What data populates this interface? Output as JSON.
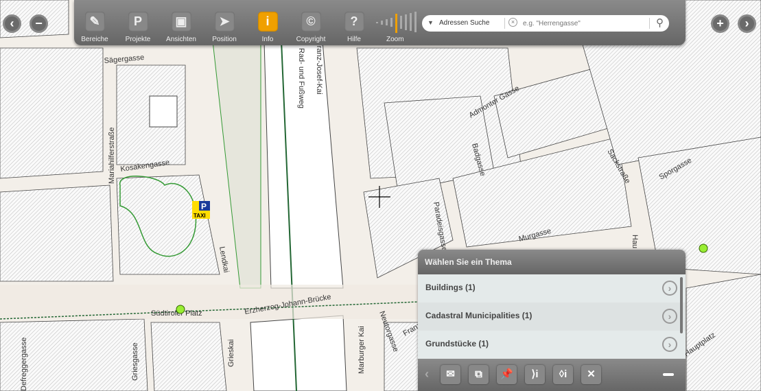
{
  "toolbar": {
    "items": [
      {
        "label": "Bereiche",
        "icon": "pencil-icon",
        "glyph": "✎"
      },
      {
        "label": "Projekte",
        "icon": "projects-icon",
        "glyph": "P"
      },
      {
        "label": "Ansichten",
        "icon": "views-icon",
        "glyph": "▣"
      },
      {
        "label": "Position",
        "icon": "location-arrow-icon",
        "glyph": "➤"
      },
      {
        "label": "Info",
        "icon": "info-icon",
        "glyph": "i",
        "active": true
      },
      {
        "label": "Copyright",
        "icon": "copyright-icon",
        "glyph": "©"
      },
      {
        "label": "Hilfe",
        "icon": "help-icon",
        "glyph": "?"
      }
    ],
    "zoom_label": "Zoom",
    "zoom_level": 5,
    "zoom_steps": 9
  },
  "search": {
    "mode": "Adressen Suche",
    "placeholder": "e.g. \"Herrengasse\""
  },
  "panel": {
    "title": "Wählen Sie ein Thema",
    "items": [
      "Buildings (1)",
      "Cadastral Municipalities (1)",
      "Grundstücke (1)"
    ]
  },
  "map": {
    "labels": [
      "Sägergasse",
      "Mariahilferstraße",
      "Kosakengasse",
      "Südtiroler Platz",
      "Defreggergasse",
      "Griesgasse",
      "Grieskai",
      "Lendkai",
      "Erzherzog-Johann-Brücke",
      "Marburger Kai",
      "Neutorgasse",
      "Franz",
      "Paradeisgasse",
      "Murgasse",
      "Badgasse",
      "Admonter Gasse",
      "Sackstraße",
      "Sporgasse",
      "Hauptplatz",
      "Rad- und Fußweg",
      "Franz-Josef-Kai",
      "Hau"
    ],
    "taxi": "TAXI",
    "parking": "P"
  },
  "colors": {
    "accent": "#f0a000",
    "toolbar": "#777777"
  }
}
